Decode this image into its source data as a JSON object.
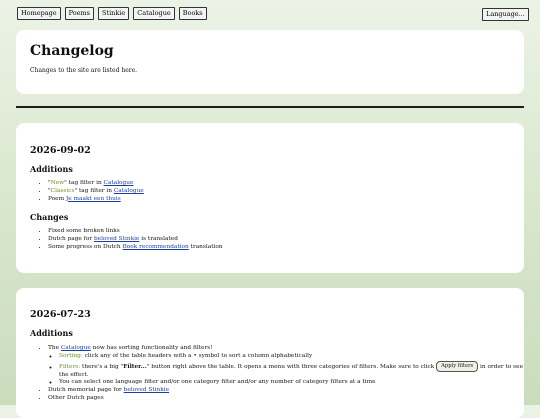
{
  "nav": {
    "items": [
      "Homepage",
      "Poems",
      "Stinkie",
      "Catalogue",
      "Books"
    ],
    "language_button": "Language..."
  },
  "header": {
    "title": "Changelog",
    "subtitle": "Changes to the site are listed here."
  },
  "entries": [
    {
      "date": "2026-09-02",
      "additions_heading": "Additions",
      "additions": [
        {
          "q1": "\"",
          "tag": "New",
          "q2": "\"",
          "pre": " tag filter in ",
          "link": "Catalogue"
        },
        {
          "q1": "\"",
          "tag": "Classics",
          "q2": "\"",
          "pre": " tag filter in ",
          "link": "Catalogue"
        },
        {
          "pre": "Poem ",
          "link": "Je maakt een thuis"
        }
      ],
      "changes_heading": "Changes",
      "changes": [
        {
          "text": "Fixed some broken links"
        },
        {
          "pre": "Dutch page for ",
          "link": "beloved Stinkie",
          "post": " is translated"
        },
        {
          "pre": "Some progress on Dutch ",
          "link": "Book recommendation",
          "post": " translation"
        }
      ]
    },
    {
      "date": "2026-07-23",
      "additions_heading": "Additions",
      "item1": {
        "pre": "The ",
        "link": "Catalogue",
        "post": " now has sorting functionality and filters!"
      },
      "sorting": {
        "label": "Sorting:",
        "text": " click any of the table headers with a • symbol to sort a column alphabetically"
      },
      "filters": {
        "label": "Filters:",
        "text1": " there's a big \"",
        "bold": "Filter...",
        "text2": "\" button right above the table. It opens a menu with three categories of filters. Make sure to click ",
        "button": "Apply filters",
        "text3": " in order to see the effect."
      },
      "select_note": "You can select one language filter and/or one category filter and/or any number of category filters at a time",
      "item2": {
        "pre": "Dutch memorial page for ",
        "link": "beloved Stinkie"
      },
      "item3": {
        "text": "Other Dutch pages"
      }
    }
  ]
}
